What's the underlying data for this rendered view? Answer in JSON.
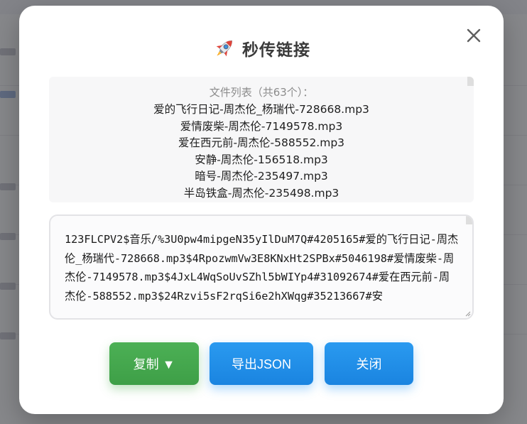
{
  "dialog": {
    "title": "秒传链接",
    "title_icon": "rocket-icon",
    "close_icon": "close-icon"
  },
  "file_list": {
    "header": "文件列表（共63个）：",
    "items": [
      "爱的飞行日记-周杰伦_杨瑞代-728668.mp3",
      "爱情废柴-周杰伦-7149578.mp3",
      "爱在西元前-周杰伦-588552.mp3",
      "安静-周杰伦-156518.mp3",
      "暗号-周杰伦-235497.mp3",
      "半岛铁盒-周杰伦-235498.mp3"
    ]
  },
  "link_box": {
    "value": "123FLCPV2$音乐/%3U0pw4mipgeN35yIlDuM7Q#4205165#爱的飞行日记-周杰伦_杨瑞代-728668.mp3$4RpozwmVw3E8KNxHt2SPBx#5046198#爱情废柴-周杰伦-7149578.mp3$4JxL4WqSoUvSZhl5bWIYp4#31092674#爱在西元前-周杰伦-588552.mp3$24Rzvi5sF2rqSi6e2hXWqg#35213667#安"
  },
  "buttons": {
    "copy_label": "复制 ▼",
    "export_label": "导出JSON",
    "close_label": "关闭"
  },
  "colors": {
    "copy_button": "#4caf50",
    "primary_button": "#2196f3"
  }
}
